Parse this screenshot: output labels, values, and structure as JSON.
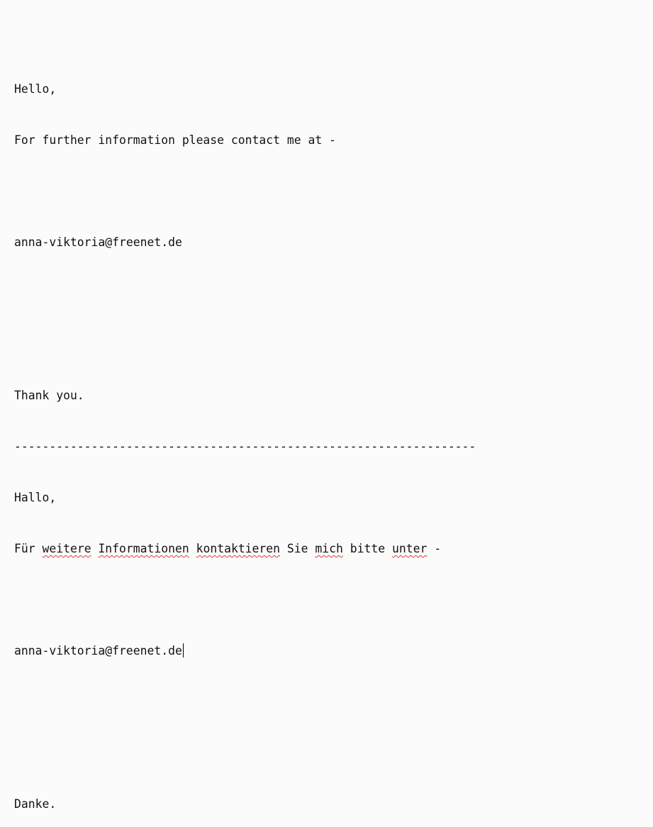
{
  "english": {
    "greeting": "Hello,",
    "info_line": "For further information please contact me at -",
    "email": "anna-viktoria@freenet.de",
    "closing": "Thank you."
  },
  "separator": "------------------------------------------------------------------",
  "german": {
    "greeting": "Hallo,",
    "info_words": [
      "Für",
      "weitere",
      "Informationen",
      "kontaktieren",
      "Sie",
      "mich",
      "bitte",
      "unter",
      "-"
    ],
    "email": "anna-viktoria@freenet.de",
    "closing": "Danke."
  },
  "colors": {
    "background": "#fbfbfb",
    "spellcheck_underline": "#e53935"
  }
}
